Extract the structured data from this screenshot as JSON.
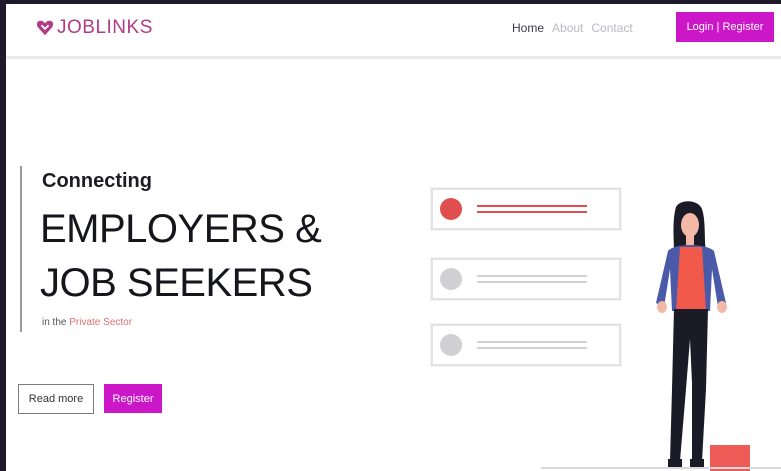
{
  "brand": {
    "name": "JOBLINKS",
    "logo_color": "#b13b86"
  },
  "nav": {
    "links": [
      {
        "label": "Home",
        "active": true
      },
      {
        "label": "About",
        "active": false
      },
      {
        "label": "Contact",
        "active": false
      }
    ],
    "login_label": "Login | Register"
  },
  "hero": {
    "kicker": "Connecting",
    "headline_line1": "EMPLOYERS &",
    "headline_line2": "JOB SEEKERS",
    "sub_prefix": "in the ",
    "sub_accent": "Private Sector",
    "read_more_label": "Read more",
    "register_label": "Register"
  },
  "colors": {
    "accent": "#cb17c7",
    "highlight": "#e04f4f",
    "inactive": "#cfcfd4"
  },
  "illustration": {
    "cards": [
      {
        "state": "active"
      },
      {
        "state": "inactive"
      },
      {
        "state": "inactive"
      }
    ],
    "figure": "woman-standing"
  }
}
